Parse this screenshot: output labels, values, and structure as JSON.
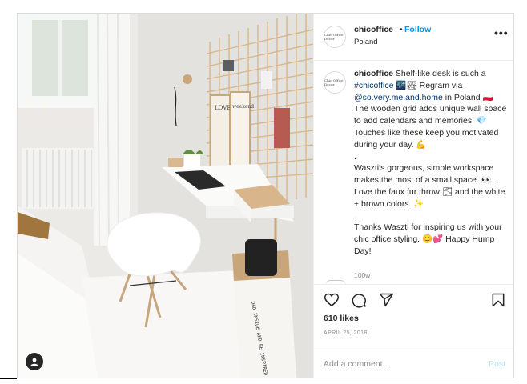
{
  "post": {
    "username": "chicoffice",
    "separator": "•",
    "follow_label": "Follow",
    "location": "Poland",
    "more_label": "•••",
    "avatar_text": "Chic Office Decor",
    "caption_lines": [
      "Shelf-like desk is such a",
      "🇵🇱 Touches like these keep you"
    ],
    "caption_parts": {
      "p1": " Shelf-like desk is such a ",
      "hashtag": "#chicoffice",
      "p2": " 🌃🏞 Regram via ",
      "mention": "@so.very.me.and.home",
      "p3": " in Poland 🇵🇱\nThe wooden grid adds unique wall space to add calendars and memories. 💎 Touches like these keep you motivated during your day. 💪\n.\nWaszti's gorgeous, simple workspace makes the most of a small space. 👀 . Love the faux fur throw 🌫 and the white + brown colors. ✨\n.\nThanks Waszti for inspiring us with your chic office styling. 😊💕 Happy Hump Day!"
    },
    "time_ago": "100w",
    "likes": "610 likes",
    "date": "APRIL 25, 2018",
    "comment_placeholder": "Add a comment...",
    "post_label": "Post",
    "icons": [
      "heart-icon",
      "comment-icon",
      "share-icon",
      "bookmark-icon",
      "user-tag-icon",
      "more-icon"
    ],
    "colors": {
      "link": "#0095f6",
      "muted": "#8e8e8e",
      "post_disabled": "#b2dffc"
    },
    "photo_labels": {
      "frame1": "LOVE",
      "frame2": "weekend",
      "bag_text": "DAD INSIDE AND BE INSPIRED"
    }
  }
}
